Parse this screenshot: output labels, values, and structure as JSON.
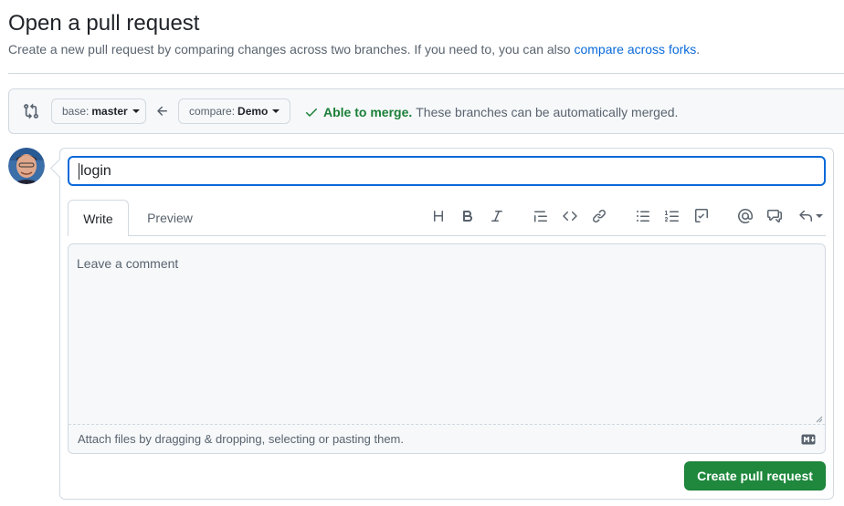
{
  "header": {
    "title": "Open a pull request",
    "subtitle": "Create a new pull request by comparing changes across two branches. If you need to, you can also",
    "subtitle_link": "compare across forks",
    "subtitle_end": "."
  },
  "compare": {
    "base_label": "base:",
    "base_value": "master",
    "compare_label": "compare:",
    "compare_value": "Demo",
    "merge_ok": "Able to merge.",
    "merge_text": "These branches can be automatically merged."
  },
  "form": {
    "title_value": "login",
    "tabs": [
      "Write",
      "Preview"
    ],
    "comment_placeholder": "Leave a comment",
    "attach_text": "Attach files by dragging & dropping, selecting or pasting them.",
    "submit_label": "Create pull request"
  },
  "toolbar": {
    "icons": [
      "heading-icon",
      "bold-icon",
      "italic-icon",
      "quote-icon",
      "code-icon",
      "link-icon",
      "unordered-list-icon",
      "ordered-list-icon",
      "task-list-icon",
      "mention-icon",
      "cross-reference-icon",
      "saved-replies-icon"
    ]
  },
  "colors": {
    "accent": "#0969da",
    "success": "#1a7f37",
    "button_green": "#1f883d"
  }
}
